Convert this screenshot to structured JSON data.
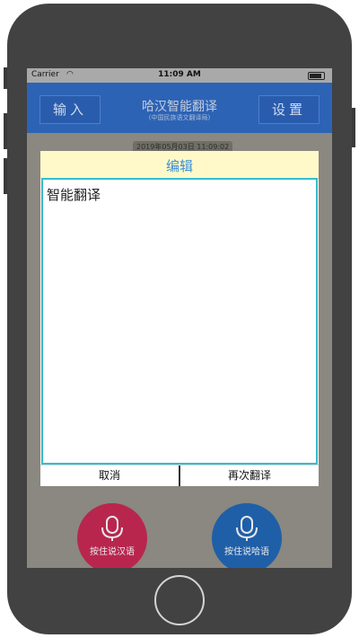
{
  "status_bar": {
    "carrier": "Carrier",
    "time": "11:09 AM"
  },
  "navbar": {
    "left_button": "输入",
    "title": "哈汉智能翻译",
    "subtitle": "(中国民族语文翻译局)",
    "right_button": "设置"
  },
  "chat": {
    "timestamp": "2019年05月03日 11:09:02"
  },
  "mic_buttons": [
    {
      "label": "按住说汉语",
      "color": "#b8264e"
    },
    {
      "label": "按住说哈语",
      "color": "#1f5fa8"
    }
  ],
  "dialog": {
    "title": "编辑",
    "text": "智能翻译",
    "cancel_label": "取消",
    "retranslate_label": "再次翻译"
  },
  "colors": {
    "navbar": "#2d63b5",
    "dialog_header": "#fff9c9",
    "dialog_title": "#3b8fd6",
    "editor_border": "#33bdd1"
  }
}
